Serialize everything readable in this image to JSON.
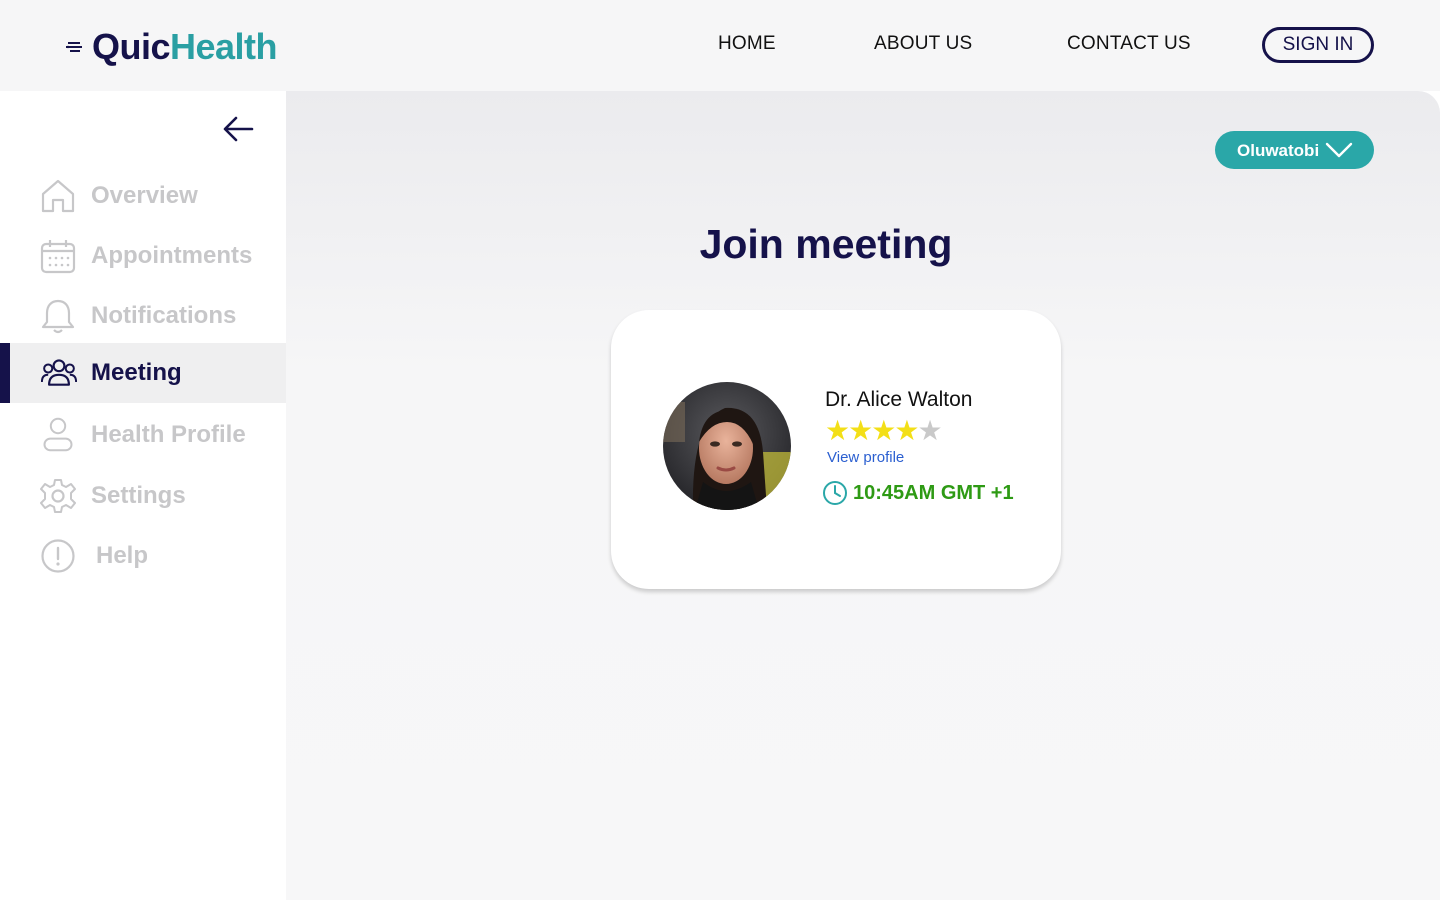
{
  "brand": {
    "part1": "Quic",
    "part2": "Health",
    "color_dark": "#15124a",
    "color_teal": "#2a9fa3"
  },
  "nav": {
    "home": "HOME",
    "about": "ABOUT US",
    "contact": "CONTACT US",
    "signin": "SIGN IN"
  },
  "sidebar": {
    "back_icon": "arrow-left-icon",
    "items": [
      {
        "label": "Overview",
        "icon": "home-icon",
        "active": false
      },
      {
        "label": "Appointments",
        "icon": "calendar-icon",
        "active": false
      },
      {
        "label": "Notifications",
        "icon": "bell-icon",
        "active": false
      },
      {
        "label": "Meeting",
        "icon": "group-icon",
        "active": true
      },
      {
        "label": "Health Profile",
        "icon": "user-icon",
        "active": false
      },
      {
        "label": "Settings",
        "icon": "gear-icon",
        "active": false
      },
      {
        "label": "Help",
        "icon": "alert-circle-icon",
        "active": false
      }
    ]
  },
  "user": {
    "name": "Oluwatobi"
  },
  "page": {
    "title": "Join meeting"
  },
  "meeting_card": {
    "doctor_name": "Dr. Alice Walton",
    "rating": 4,
    "rating_max": 5,
    "view_profile": "View profile",
    "time": "10:45AM GMT +1"
  },
  "colors": {
    "accent": "#15124a",
    "teal": "#2aa7a8",
    "time_green": "#2e9a14",
    "link_blue": "#2b5fd0",
    "star": "#f3df17"
  }
}
